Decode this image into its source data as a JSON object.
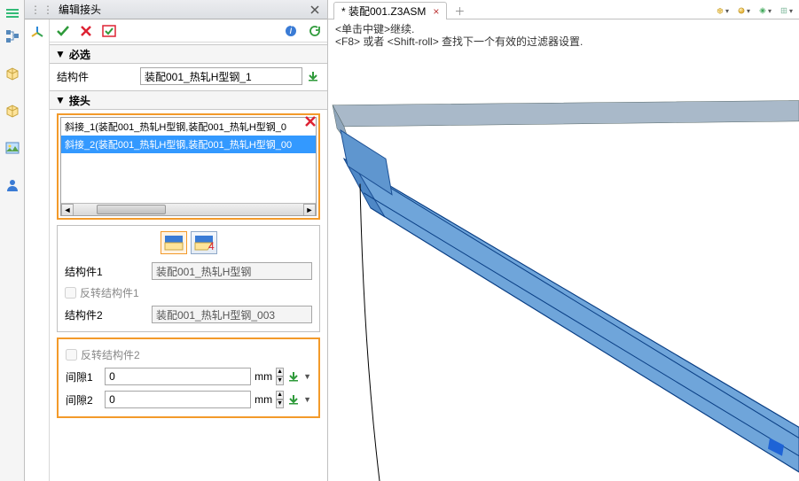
{
  "panel": {
    "title": "编辑接头",
    "sections": {
      "required": "必选",
      "joints": "接头"
    },
    "fields": {
      "struct_label": "结构件",
      "struct_value": "装配001_热轧H型钢_1",
      "list": {
        "item0": "斜接_1(装配001_热轧H型钢,装配001_热轧H型钢_0",
        "item1": "斜接_2(装配001_热轧H型钢,装配001_热轧H型钢_00"
      },
      "struct1_label": "结构件1",
      "struct1_value": "装配001_热轧H型钢",
      "flip1_label": "反转结构件1",
      "struct2_label": "结构件2",
      "struct2_value": "装配001_热轧H型钢_003",
      "flip2_label": "反转结构件2",
      "gap1_label": "间隙1",
      "gap1_value": "0",
      "gap2_label": "间隙2",
      "gap2_value": "0",
      "unit": "mm"
    }
  },
  "tabs": {
    "active": "* 装配001.Z3ASM"
  },
  "hints": {
    "line1": "<单击中键>继续.",
    "line2": "<F8> 或者 <Shift-roll> 查找下一个有效的过滤器设置."
  },
  "iconbox45": "45°"
}
